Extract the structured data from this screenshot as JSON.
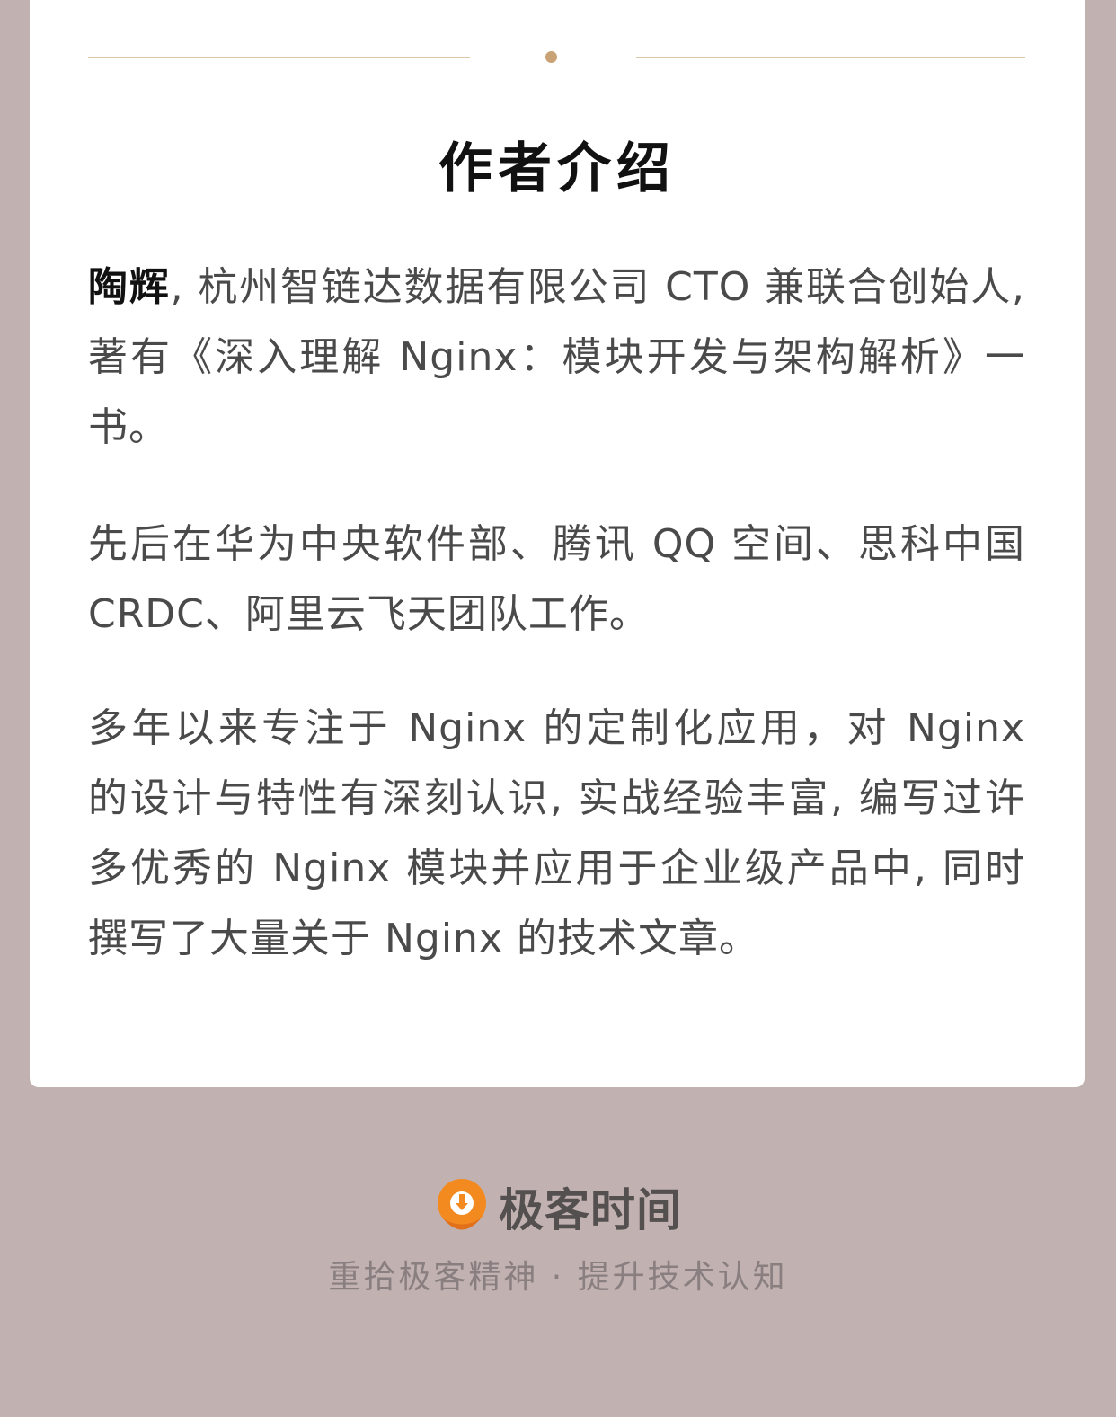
{
  "section": {
    "title": "作者介绍"
  },
  "bio": {
    "name": "陶辉",
    "intro": ", 杭州智链达数据有限公司 CTO 兼联合创始人, 著有《深入理解 Nginx：模块开发与架构解析》一书。",
    "career": "先后在华为中央软件部、腾讯 QQ 空间、思科中国 CRDC、阿里云飞天团队工作。",
    "expertise": "多年以来专注于 Nginx 的定制化应用，对 Nginx 的设计与特性有深刻认识, 实战经验丰富, 编写过许多优秀的 Nginx 模块并应用于企业级产品中, 同时撰写了大量关于 Nginx 的技术文章。"
  },
  "footer": {
    "brand_name": "极客时间",
    "logo_icon": "geektime-logo-icon",
    "slogan": "重拾极客精神 · 提升技术认知"
  },
  "colors": {
    "background": "#c2b1b1",
    "card": "#ffffff",
    "divider_line": "#dcc6a8",
    "divider_dot": "#c9a275",
    "logo_orange": "#f28a20"
  }
}
